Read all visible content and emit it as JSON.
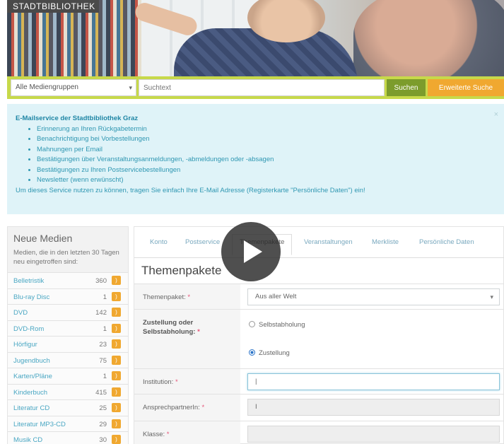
{
  "header": {
    "logo_text": "STADTBIBLIOTHEK"
  },
  "search": {
    "media_group_selected": "Alle Mediengruppen",
    "placeholder": "Suchtext",
    "search_label": "Suchen",
    "advanced_label": "Erweiterte Suche"
  },
  "info": {
    "title": "E-Mailservice der Stadtbibliothek Graz",
    "items": [
      "Erinnerung an Ihren Rückgabetermin",
      "Benachrichtigung bei Vorbestellungen",
      "Mahnungen per Email",
      "Bestätigungen über Veranstaltungsanmeldungen, -abmeldungen oder -absagen",
      "Bestätigungen zu Ihren Postservicebestellungen",
      "Newsletter (wenn erwünscht)"
    ],
    "footer": "Um dieses Service nutzen zu können, tragen Sie einfach Ihre E-Mail Adresse (Registerkarte \"Persönliche Daten\") ein!",
    "close_glyph": "×"
  },
  "sidebar": {
    "title": "Neue Medien",
    "description": "Medien, die in den letzten 30 Tagen neu eingetroffen sind:",
    "items": [
      {
        "label": "Belletristik",
        "count": "360"
      },
      {
        "label": "Blu-ray Disc",
        "count": "1"
      },
      {
        "label": "DVD",
        "count": "142"
      },
      {
        "label": "DVD-Rom",
        "count": "1"
      },
      {
        "label": "Hörfigur",
        "count": "23"
      },
      {
        "label": "Jugendbuch",
        "count": "75"
      },
      {
        "label": "Karten/Pläne",
        "count": "1"
      },
      {
        "label": "Kinderbuch",
        "count": "415"
      },
      {
        "label": "Literatur CD",
        "count": "25"
      },
      {
        "label": "Literatur MP3-CD",
        "count": "29"
      },
      {
        "label": "Musik CD",
        "count": "30"
      }
    ]
  },
  "tabs": [
    {
      "label": "Konto"
    },
    {
      "label": "Postservice"
    },
    {
      "label": "Themenpakete"
    },
    {
      "label": "Veranstaltungen"
    },
    {
      "label": "Merkliste"
    },
    {
      "label": "Persönliche Daten"
    }
  ],
  "main": {
    "title": "Themenpakete"
  },
  "form": {
    "themenpaket_label": "Themenpaket:",
    "themenpaket_value": "Aus aller Welt",
    "zustellung_label": "Zustellung oder Selbstabholung:",
    "option_selbst": "Selbstabholung",
    "option_zustellung": "Zustellung",
    "institution_label": "Institution:",
    "ansprech_label": "AnsprechpartnerIn:",
    "klasse_label": "Klasse:",
    "required_mark": "*"
  },
  "colors": {
    "search_bar": "#c7d94a",
    "search_button": "#7c9c2c",
    "advanced_button": "#f0a830",
    "info_background": "#dff3f8",
    "link": "#4aa7c3",
    "rss": "#f0a830"
  }
}
